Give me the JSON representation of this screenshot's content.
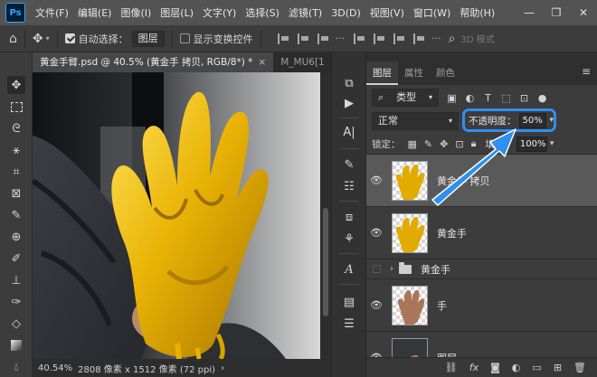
{
  "app": {
    "logo": "Ps"
  },
  "menu": [
    "文件(F)",
    "编辑(E)",
    "图像(I)",
    "图层(L)",
    "文字(Y)",
    "选择(S)",
    "滤镜(T)",
    "3D(D)",
    "视图(V)",
    "窗口(W)",
    "帮助(H)"
  ],
  "window_controls": {
    "minimize": "—",
    "maximize": "❐",
    "close": "✕"
  },
  "options_bar": {
    "auto_select_label": "自动选择：",
    "auto_select_checked": true,
    "auto_select_target": "图层",
    "show_transform_label": "显示变换控件",
    "show_transform_checked": false,
    "mode_3d_label": "3D 模式"
  },
  "document": {
    "tabs": [
      {
        "label": "黄金手臂.psd @ 40.5% (黄金手 拷贝, RGB/8*) *",
        "active": true
      },
      {
        "label": "M_MU6[1",
        "active": false
      }
    ],
    "close_glyph": "×",
    "status": {
      "zoom": "40.54%",
      "dimensions": "2808 像素 x 1512 像素 (72 ppi)",
      "arrow": "›"
    }
  },
  "layers_panel": {
    "tabs": [
      "图层",
      "属性",
      "颜色"
    ],
    "menu_glyph": "≡",
    "filter_kind": "类型",
    "blend_mode": "正常",
    "opacity_label": "不透明度：",
    "opacity_value": "50%",
    "lock_label": "锁定：",
    "fill_label": "填充：",
    "fill_value": "100%",
    "layers": [
      {
        "name": "黄金手 拷贝",
        "visible": true,
        "selected": true,
        "type": "gold-hand"
      },
      {
        "name": "黄金手",
        "visible": true,
        "selected": false,
        "type": "gold-hand"
      },
      {
        "name": "黄金手",
        "visible": false,
        "selected": false,
        "type": "group"
      },
      {
        "name": "手",
        "visible": true,
        "selected": false,
        "type": "skin-hand"
      },
      {
        "name": "图层",
        "visible": true,
        "selected": false,
        "type": "photo"
      }
    ],
    "bottom_icons": [
      "link-icon",
      "fx-icon",
      "mask-icon",
      "adjustment-icon",
      "folder-icon",
      "new-layer-icon",
      "trash-icon"
    ]
  },
  "annotation": {
    "color": "#2e8ff0"
  }
}
